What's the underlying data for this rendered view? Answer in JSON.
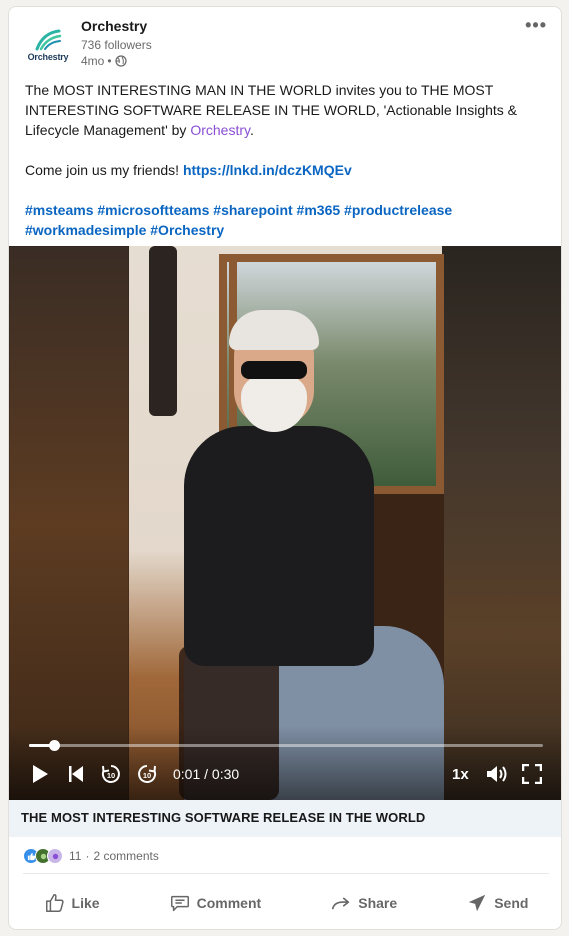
{
  "post": {
    "company_name": "Orchestry",
    "logo_text": "Orchestry",
    "followers": "736 followers",
    "time_ago": "4mo",
    "time_separator": "•",
    "more_label": "•••",
    "text_part1": "The MOST INTERESTING MAN IN THE WORLD invites you to THE MOST INTERESTING SOFTWARE RELEASE IN THE WORLD, 'Actionable Insights & Lifecycle Management' by ",
    "mention": "Orchestry",
    "text_part2": ".",
    "invite_text": "Come join us my friends! ",
    "link": "https://lnkd.in/dczKMQEv",
    "hashtags_line1": "#msteams #microsoftteams #sharepoint #m365 #productrelease",
    "hashtags_line2": "#workmadesimple #Orchestry"
  },
  "video": {
    "current_time": "0:01",
    "duration": "0:30",
    "time_display": "0:01 / 0:30",
    "progress_fraction": 0.048,
    "speed": "1x",
    "icons": [
      "play-icon",
      "skip-back-icon",
      "rewind-10-icon",
      "forward-10-icon",
      "volume-icon",
      "fullscreen-icon"
    ]
  },
  "caption": "THE MOST INTERESTING SOFTWARE RELEASE IN THE WORLD",
  "social": {
    "reaction_count": "11",
    "separator": "·",
    "comments": "2 comments",
    "reaction_colors": [
      "#378fe9",
      "#44712e",
      "#8a4fd4"
    ]
  },
  "actions": {
    "like": "Like",
    "comment": "Comment",
    "share": "Share",
    "send": "Send"
  },
  "colors": {
    "link": "#0a66c2",
    "mention": "#8a4fd4",
    "caption_bg": "#eef3f8"
  }
}
